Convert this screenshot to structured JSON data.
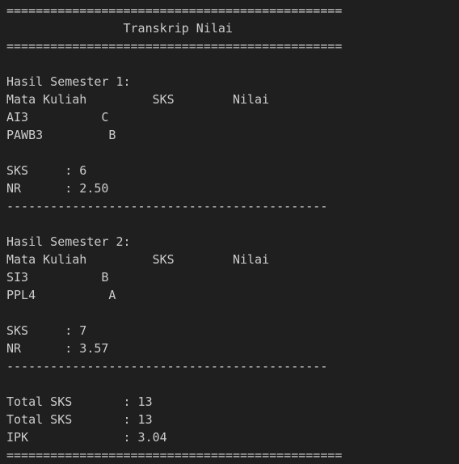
{
  "terminal": {
    "lines": [
      "==============================================",
      "                Transkrip Nilai",
      "==============================================",
      "",
      "Hasil Semester 1:",
      "Mata Kuliah         SKS        Nilai",
      "AI3          C",
      "PAWB3         B",
      "",
      "SKS     : 6",
      "NR      : 2.50",
      "--------------------------------------------",
      "",
      "Hasil Semester 2:",
      "Mata Kuliah         SKS        Nilai",
      "SI3          B",
      "PPL4          A",
      "",
      "SKS     : 7",
      "NR      : 3.57",
      "--------------------------------------------",
      "",
      "Total SKS       : 13",
      "Total SKS       : 13",
      "IPK             : 3.04",
      "=============================================="
    ]
  }
}
